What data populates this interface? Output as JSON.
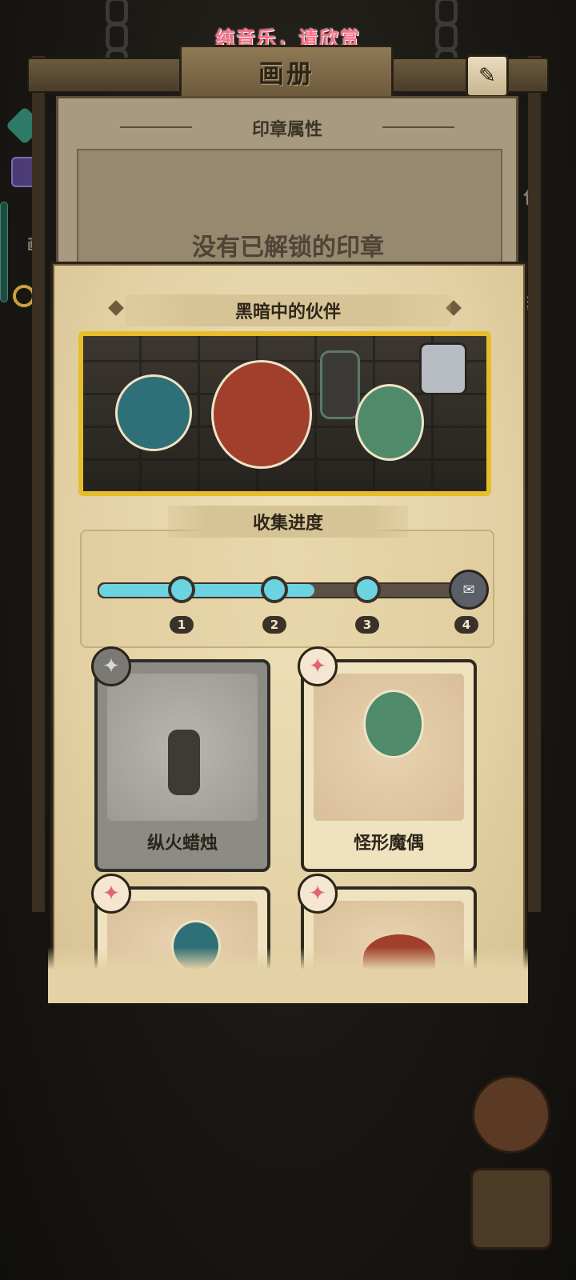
{
  "top_banner": "纯音乐，请欣赏",
  "window": {
    "title": "画册"
  },
  "side_labels": {
    "left": "画",
    "right_top": "包",
    "right_bottom": "照"
  },
  "seal_panel": {
    "title": "印章属性",
    "empty_text": "没有已解锁的印章"
  },
  "album": {
    "title": "黑暗中的伙伴",
    "progress_title": "收集进度",
    "progress": {
      "collected": 3,
      "total": 4,
      "milestones": [
        "1",
        "2",
        "3",
        "4"
      ]
    },
    "cards": [
      {
        "name": "纵火蜡烛",
        "locked": true
      },
      {
        "name": "怪形魔偶",
        "locked": false
      },
      {
        "name": "",
        "locked": false
      },
      {
        "name": "",
        "locked": false
      }
    ]
  },
  "icons": {
    "paw": "paw-icon",
    "brush": "brush-icon",
    "search": "magnifier-icon",
    "reward": "reward-icon"
  },
  "colors": {
    "accent_gold": "#e6bd2a",
    "progress_fill": "#6cd3e0",
    "banner_pink": "#ff6f88"
  }
}
